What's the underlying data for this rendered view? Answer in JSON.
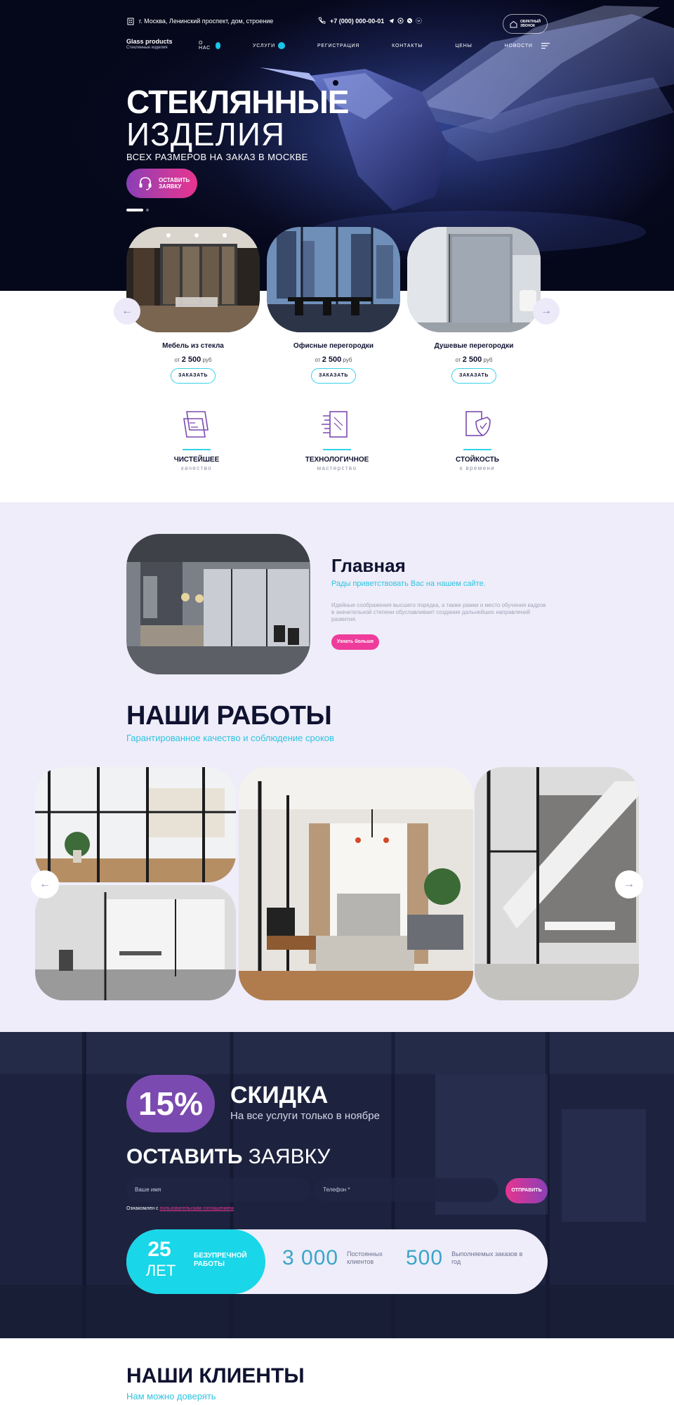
{
  "header": {
    "address": "г. Москва, Ленинский проспект, дом, строение",
    "phone": "+7 (000) 000-00-01",
    "callback_line1": "ОБРАТНЫЙ",
    "callback_line2": "ЗВОНОК"
  },
  "nav": {
    "brand": "Glass products",
    "brand_sub": "Стеклянные изделия",
    "items": [
      {
        "label": "О НАС"
      },
      {
        "label": "УСЛУГИ"
      },
      {
        "label": "РЕГИСТРАЦИЯ"
      },
      {
        "label": "КОНТАКТЫ"
      },
      {
        "label": "ЦЕНЫ"
      },
      {
        "label": "НОВОСТИ"
      }
    ]
  },
  "hero": {
    "title_line1": "СТЕКЛЯННЫЕ",
    "title_line2": "ИЗДЕЛИЯ",
    "subtitle": "ВСЕХ РАЗМЕРОВ НА ЗАКАЗ В МОСКВЕ",
    "cta_line1": "ОСТАВИТЬ",
    "cta_line2": "ЗАЯВКУ",
    "slides_total": 2,
    "active_slide": 1
  },
  "products": [
    {
      "name": "Мебель из стекла",
      "price_prefix": "от",
      "price": "2 500",
      "currency": "руб",
      "button": "ЗАКАЗАТЬ"
    },
    {
      "name": "Офисные перегородки",
      "price_prefix": "от",
      "price": "2 500",
      "currency": "руб",
      "button": "ЗАКАЗАТЬ"
    },
    {
      "name": "Душевые перегородки",
      "price_prefix": "от",
      "price": "2 500",
      "currency": "руб",
      "button": "ЗАКАЗАТЬ"
    }
  ],
  "features": [
    {
      "title": "ЧИСТЕЙШЕЕ",
      "subtitle": "качество",
      "icon": "glass-pane-icon"
    },
    {
      "title": "ТЕХНОЛОГИЧНОЕ",
      "subtitle": "мастерство",
      "icon": "tech-glass-icon"
    },
    {
      "title": "СТОЙКОСТЬ",
      "subtitle": "к времени",
      "icon": "shield-glass-icon"
    }
  ],
  "about": {
    "title": "Главная",
    "subtitle": "Рады приветствовать Вас на нашем сайте.",
    "body": "Идейные соображения высшего порядка, а также рамки и место обучения кадров в значительной степени обуславливает создание дальнейших направлений развития.",
    "button": "Узнать больше"
  },
  "works": {
    "title": "НАШИ РАБОТЫ",
    "subtitle": "Гарантированное качество и соблюдение сроков"
  },
  "discount": {
    "percent": "15%",
    "title": "СКИДКА",
    "subtitle": "На все услуги только в ноябре"
  },
  "form": {
    "title_bold": "ОСТАВИТЬ",
    "title_rest": " ЗАЯВКУ",
    "name_placeholder": "Ваше имя",
    "phone_placeholder": "Телефон *",
    "submit": "ОТПРАВИТЬ",
    "consent_text": "Ознакомлен с ",
    "consent_link": "пользовательским соглашением"
  },
  "stats": {
    "highlight": {
      "number": "25",
      "unit": "ЛЕТ",
      "label_line1": "БЕЗУПРЕЧНОЙ",
      "label_line2": "РАБОТЫ"
    },
    "items": [
      {
        "number": "3 000",
        "label": "Постоянных клиентов"
      },
      {
        "number": "500",
        "label": "Выполняемых заказов в год"
      }
    ]
  },
  "clients": {
    "title": "НАШИ КЛИЕНТЫ",
    "subtitle": "Нам можно доверять"
  },
  "colors": {
    "accent_cyan": "#19d6e8",
    "accent_pink": "#e8348f",
    "accent_purple": "#7b4ab0",
    "dark_navy": "#05071a",
    "lavender_bg": "#eeedf9"
  }
}
